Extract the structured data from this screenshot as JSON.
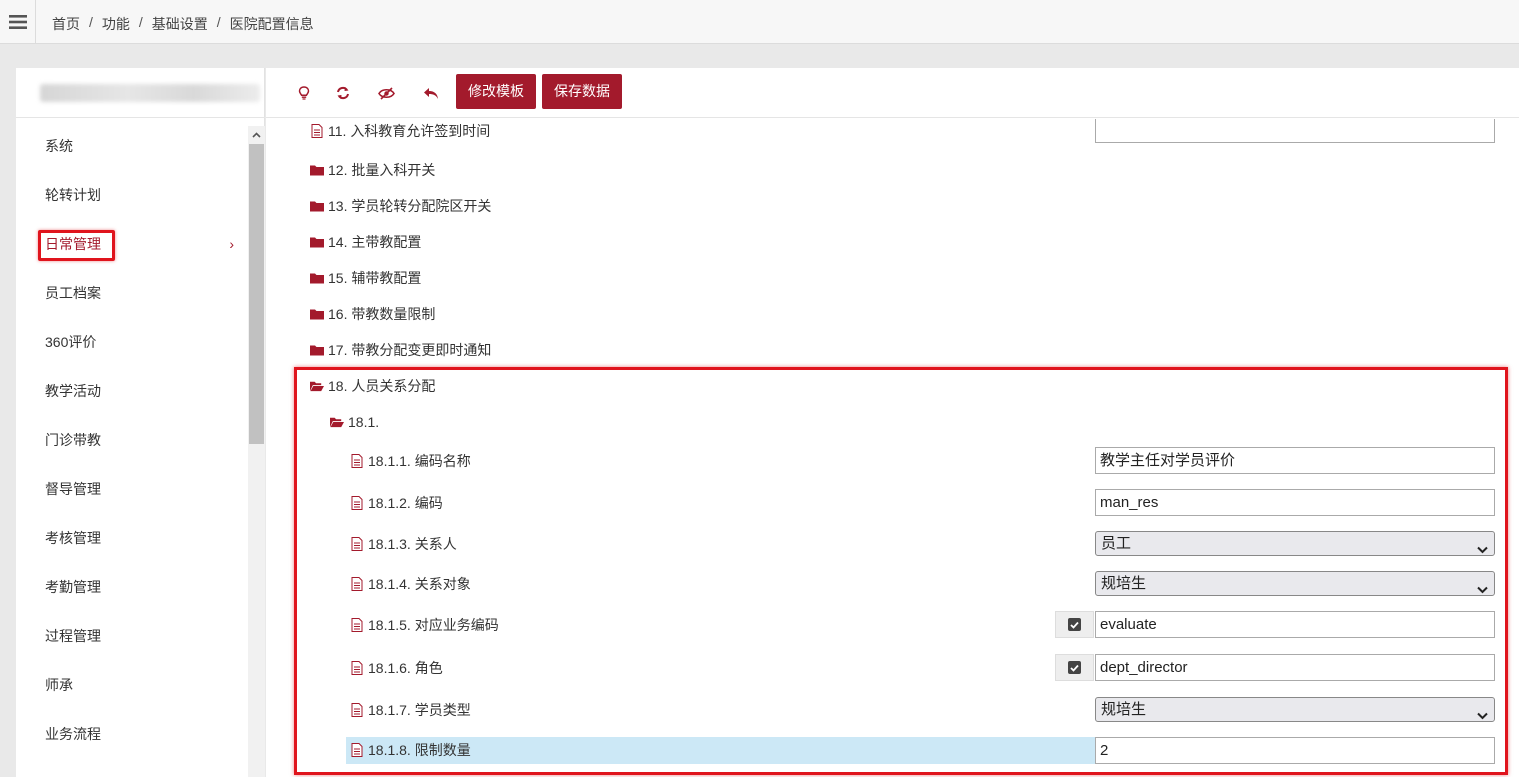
{
  "breadcrumb": {
    "items": [
      "首页",
      "功能",
      "基础设置",
      "医院配置信息"
    ],
    "separator": "/"
  },
  "icons": {
    "menu": "hamburger-icon",
    "bulb": "lightbulb-icon",
    "refresh": "refresh-icon",
    "eye": "eye-slash-icon",
    "undo": "undo-icon",
    "file": "file-text-icon",
    "folder": "folder-icon",
    "folder_open": "folder-open-icon",
    "checkbox": "checked-checkbox-icon"
  },
  "colors": {
    "accent": "#a31a2c",
    "highlight_border": "#e0141d",
    "selected_row": "#cce8f6"
  },
  "sidebar": {
    "items": [
      {
        "label": "系统"
      },
      {
        "label": "轮转计划"
      },
      {
        "label": "日常管理",
        "active": true,
        "arrow": "›"
      },
      {
        "label": "员工档案"
      },
      {
        "label": "360评价"
      },
      {
        "label": "教学活动"
      },
      {
        "label": "门诊带教"
      },
      {
        "label": "督导管理"
      },
      {
        "label": "考核管理"
      },
      {
        "label": "考勤管理"
      },
      {
        "label": "过程管理"
      },
      {
        "label": "师承"
      },
      {
        "label": "业务流程"
      }
    ]
  },
  "toolbar": {
    "edit_template": "修改模板",
    "save_data": "保存数据"
  },
  "tree": {
    "n11": "11. 入科教育允许签到时间",
    "n11_value": "",
    "n12": "12. 批量入科开关",
    "n13": "13. 学员轮转分配院区开关",
    "n14": "14. 主带教配置",
    "n15": "15. 辅带教配置",
    "n16": "16. 带教数量限制",
    "n17": "17. 带教分配变更即时通知",
    "n18": "18. 人员关系分配",
    "n18_1": "18.1.",
    "f1_label": "18.1.1. 编码名称",
    "f1_value": "教学主任对学员评价",
    "f2_label": "18.1.2. 编码",
    "f2_value": "man_res",
    "f3_label": "18.1.3. 关系人",
    "f3_value": "员工",
    "f4_label": "18.1.4. 关系对象",
    "f4_value": "规培生",
    "f5_label": "18.1.5. 对应业务编码",
    "f5_value": "evaluate",
    "f6_label": "18.1.6. 角色",
    "f6_value": "dept_director",
    "f7_label": "18.1.7. 学员类型",
    "f7_value": "规培生",
    "f8_label": "18.1.8. 限制数量",
    "f8_value": "2"
  }
}
